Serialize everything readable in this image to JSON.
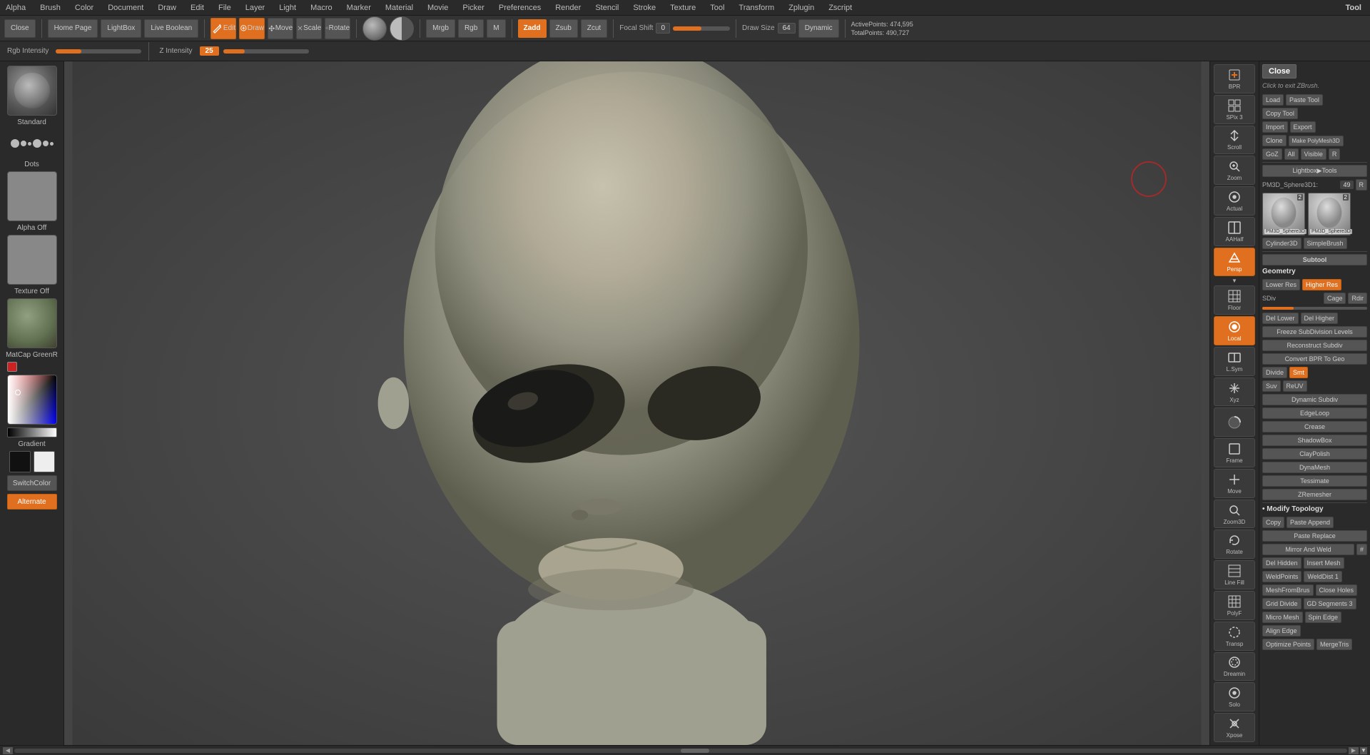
{
  "menu": {
    "items": [
      "Alpha",
      "Brush",
      "Color",
      "Document",
      "Draw",
      "Edit",
      "File",
      "Layer",
      "Light",
      "Macro",
      "Marker",
      "Material",
      "Movie",
      "Picker",
      "Preferences",
      "Render",
      "Stencil",
      "Stroke",
      "Texture",
      "Tool",
      "Transform",
      "Zplugin",
      "Zscript"
    ]
  },
  "toolbar": {
    "close_label": "Close",
    "home_label": "Home Page",
    "lightbox_label": "LightBox",
    "livebool_label": "Live Boolean",
    "edit_label": "Edit",
    "draw_label": "Draw",
    "move_label": "Move",
    "scale_label": "Scale",
    "rotate_label": "Rotate",
    "mrgb_label": "Mrgb",
    "rgb_label": "Rgb",
    "m_label": "M",
    "zadd_label": "Zadd",
    "zsub_label": "Zsub",
    "zcut_label": "Zcut",
    "focal_shift_label": "Focal Shift",
    "focal_shift_val": "0",
    "draw_size_label": "Draw Size",
    "draw_size_val": "64",
    "dynamic_label": "Dynamic",
    "z_intensity_label": "Z Intensity",
    "z_intensity_val": "25",
    "rgb_intensity_label": "Rgb Intensity",
    "active_points_label": "ActivePoints:",
    "active_points_val": "474,595",
    "total_points_label": "TotalPoints:",
    "total_points_val": "490,727"
  },
  "left_sidebar": {
    "standard_label": "Standard",
    "dots_label": "Dots",
    "alpha_label": "Alpha Off",
    "texture_label": "Texture Off",
    "matcap_label": "MatCap GreenR",
    "gradient_label": "Gradient",
    "switch_label": "SwitchColor",
    "alternate_label": "Alternate"
  },
  "right_icon_bar": {
    "items": [
      {
        "id": "bpr",
        "label": "BPR",
        "icon": "▣"
      },
      {
        "id": "spix",
        "label": "SPix 3",
        "icon": "⊞"
      },
      {
        "id": "scroll",
        "label": "Scroll",
        "icon": "↕"
      },
      {
        "id": "zoom",
        "label": "Zoom",
        "icon": "⊕"
      },
      {
        "id": "actual",
        "label": "Actual",
        "icon": "⊙"
      },
      {
        "id": "aahalf",
        "label": "AAHalf",
        "icon": "◫"
      },
      {
        "id": "persp",
        "label": "Persp",
        "icon": "◧"
      },
      {
        "id": "floor",
        "label": "Floor",
        "icon": "▦"
      },
      {
        "id": "local",
        "label": "Local",
        "icon": "◉"
      },
      {
        "id": "lsym",
        "label": "L.Sym",
        "icon": "⊟"
      },
      {
        "id": "xyz",
        "label": "Xyz",
        "icon": "✛"
      },
      {
        "id": "activate",
        "label": "",
        "icon": "◐"
      },
      {
        "id": "frame",
        "label": "Frame",
        "icon": "▢"
      },
      {
        "id": "move",
        "label": "Move",
        "icon": "✥"
      },
      {
        "id": "zoom3d",
        "label": "Zoom3D",
        "icon": "⊕"
      },
      {
        "id": "rotate",
        "label": "Rotate",
        "icon": "↺"
      },
      {
        "id": "linefill",
        "label": "Line Fill",
        "icon": "▤"
      },
      {
        "id": "polyf",
        "label": "PolyF",
        "icon": "▦"
      },
      {
        "id": "transp",
        "label": "Transp",
        "icon": "◌"
      },
      {
        "id": "dreamin",
        "label": "Dreamin",
        "icon": "◈"
      },
      {
        "id": "solo",
        "label": "Solo",
        "icon": "◎"
      },
      {
        "id": "xpose",
        "label": "Xpose",
        "icon": "✦"
      }
    ]
  },
  "right_panel": {
    "tool_label": "Tool",
    "close_label": "Close",
    "click_tip": "Click to exit ZBrush.",
    "load_label": "Load",
    "paste_tool_label": "Paste Tool",
    "copy_tool_label": "Copy Tool",
    "import_label": "Import",
    "export_label": "Export",
    "clone_label": "Clone",
    "make_polymesh_label": "Make PolyMesh3D",
    "goz_label": "GoZ",
    "all_label": "All",
    "visible_label": "Visible",
    "r_label": "R",
    "lightbox_tools_label": "Lightbox▶Tools",
    "pm3d_sphere_label": "PM3D_Sphere3D1:",
    "pm3d_sphere_val": "49",
    "r2_label": "R",
    "models": [
      {
        "label": "PM3D_Sphere3D",
        "badge": "2"
      },
      {
        "label": "PM3D_Sphere3D",
        "badge": "2"
      }
    ],
    "cylinder_label": "Cylinder3D",
    "simple_brush_label": "SimpleBrush",
    "subtool_label": "Subtool",
    "geometry_label": "Geometry",
    "lower_res_label": "Lower Res",
    "higher_res_label": "Higher Res",
    "cage_label": "Cage",
    "rdir_label": "Rdir",
    "sdiv_label": "SDiv",
    "del_lower_label": "Del Lower",
    "del_higher_label": "Del Higher",
    "freeze_subdiv_label": "Freeze SubDivision Levels",
    "reconstruct_label": "Reconstruct Subdiv",
    "convert_bpr_label": "Convert BPR To Geo",
    "divide_label": "Divide",
    "smt_label": "Smt",
    "suv_label": "Suv",
    "reuv_label": "ReUV",
    "dynamic_subdiv_label": "Dynamic Subdiv",
    "edgeloop_label": "EdgeLoop",
    "crease_label": "Crease",
    "shadowbox_label": "ShadowBox",
    "claypolish_label": "ClayPolish",
    "dynamesh_label": "DynaMesh",
    "tessimate_label": "Tessimate",
    "zremesher_label": "ZRemesher",
    "modify_topology_label": "• Modify Topology",
    "copy_label": "Copy",
    "paste_append_label": "Paste Append",
    "paste_replace_label": "Paste Replace",
    "mirror_weld_label": "Mirror And Weld",
    "hash_label": "#",
    "del_hidden_label": "Del Hidden",
    "insert_mesh_label": "Insert Mesh",
    "weld_points_label": "WeldPoints",
    "weld_dist_label": "WeldDist 1",
    "mesh_frombrus_label": "MeshFromBrus",
    "close_holes_label": "Close Holes",
    "grid_divide_label": "Grid Divide",
    "gd_segments_label": "GD Segments 3",
    "micro_mesh_label": "Micro Mesh",
    "spin_edge_label": "Spin Edge",
    "align_edge_label": "Align Edge",
    "optimize_points_label": "Optimize Points",
    "merge_tris_label": "MergeTris"
  },
  "canvas": {
    "bg_color": "#444444"
  }
}
